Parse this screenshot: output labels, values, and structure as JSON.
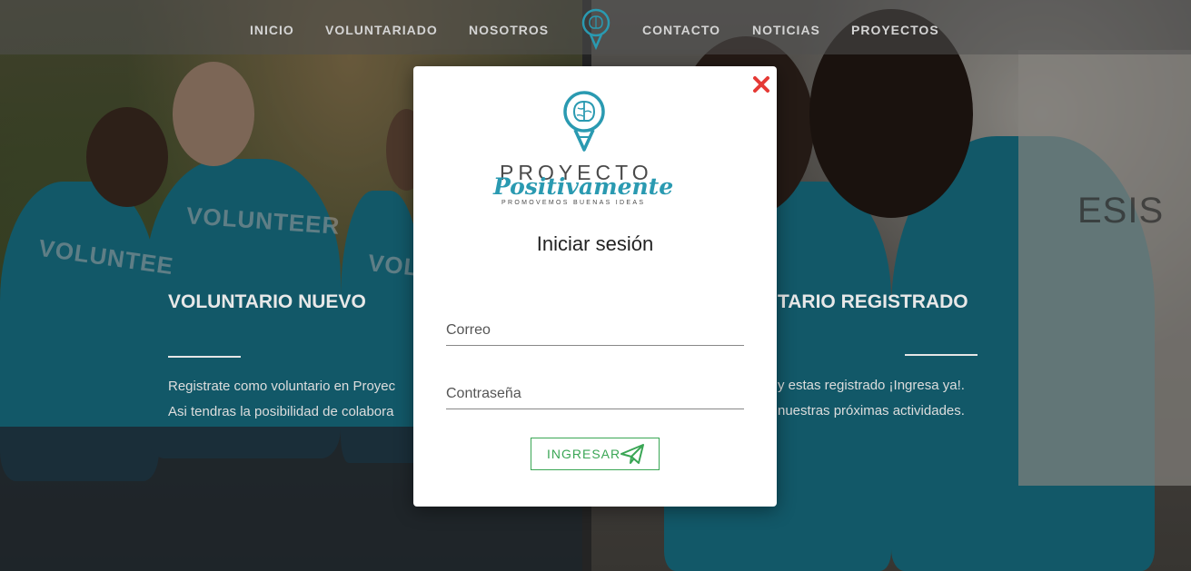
{
  "nav": {
    "items": [
      {
        "label": "INICIO"
      },
      {
        "label": "VOLUNTARIADO"
      },
      {
        "label": "NOSOTROS"
      },
      {
        "label": "CONTACTO"
      },
      {
        "label": "NOTICIAS"
      },
      {
        "label": "PROYECTOS"
      }
    ],
    "logo_icon": "lightbulb-brain-icon"
  },
  "left_panel": {
    "title": "VOLUNTARIO NUEVO",
    "text_line1": "Registrate como voluntario en Proyec",
    "text_line2": "Asi tendras la posibilidad de colabora",
    "shirt_text1": "VOLUNTEER",
    "shirt_text2": "VOLUNTEE",
    "shirt_text3": "VOLU"
  },
  "right_panel": {
    "title": "TARIO REGISTRADO",
    "text_line1": "y estas registrado ¡Ingresa ya!.",
    "text_line2": "nuestras próximas actividades.",
    "wall_text": "ESIS"
  },
  "modal": {
    "close_icon": "close-icon",
    "logo": {
      "word1": "PROYECTO",
      "word2": "Positivamente",
      "tagline": "PROMOVEMOS BUENAS IDEAS"
    },
    "title": "Iniciar sesión",
    "email_placeholder": "Correo",
    "password_placeholder": "Contraseña",
    "submit_label": "INGRESAR",
    "submit_icon": "paper-plane-icon"
  },
  "colors": {
    "brand_teal": "#2a9ab1",
    "button_green": "#3aa655",
    "close_red": "#e53935"
  }
}
